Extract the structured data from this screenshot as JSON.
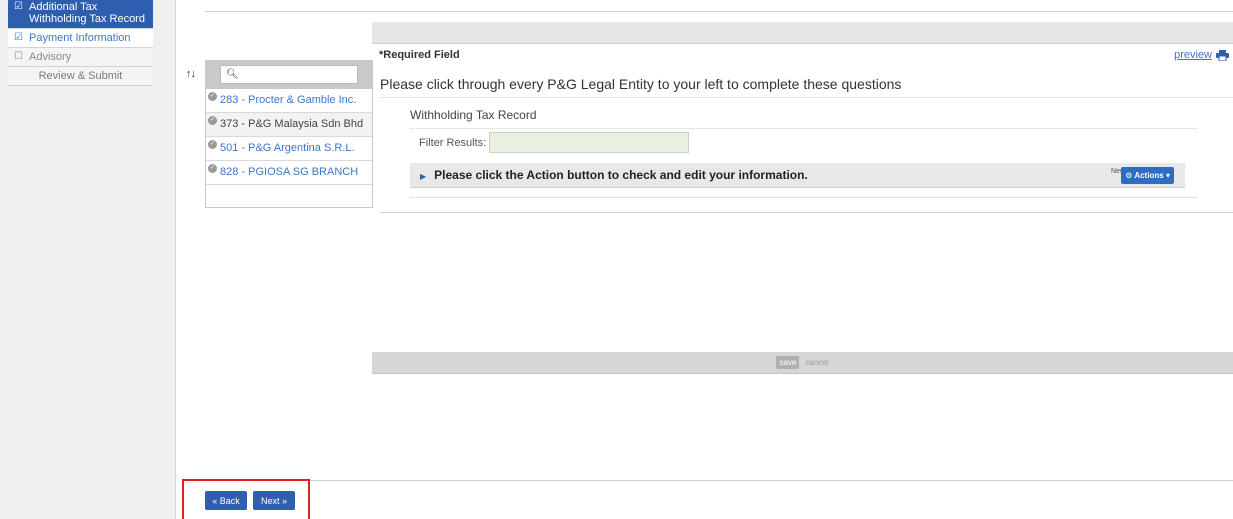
{
  "sidebar": {
    "steps": [
      {
        "label": "Additional Tax Withholding Tax Record",
        "state": "active",
        "checked": true
      },
      {
        "label": "Payment Information",
        "state": "done",
        "checked": true
      },
      {
        "label": "Advisory",
        "state": "pending",
        "checked": false
      },
      {
        "label": "Review & Submit",
        "state": "review",
        "checked": false
      }
    ]
  },
  "entities": {
    "search_placeholder": "",
    "items": [
      {
        "label": "283 - Procter & Gamble Inc.",
        "selected": false
      },
      {
        "label": "373 - P&G Malaysia Sdn Bhd",
        "selected": true
      },
      {
        "label": "501 - P&G Argentina S.R.L.",
        "selected": false
      },
      {
        "label": "828 - PGIOSA SG BRANCH",
        "selected": false
      }
    ]
  },
  "main": {
    "required_label": "*Required Field",
    "preview_label": "preview",
    "instruction": "Please click through every P&G Legal Entity to your left to complete these questions",
    "section_title": "Withholding Tax Record",
    "filter_label": "Filter Results:",
    "filter_value": "",
    "action_text": "Please click the Action button to check and edit your information.",
    "new_label": "New",
    "actions_label": "Actions ▾",
    "save_label": "save",
    "cancel_label": "cancel"
  },
  "nav": {
    "back_label": "« Back",
    "next_label": "Next »"
  },
  "colors": {
    "accent": "#2d5eb0",
    "link": "#3d76c6",
    "highlight_box": "#e02020"
  }
}
